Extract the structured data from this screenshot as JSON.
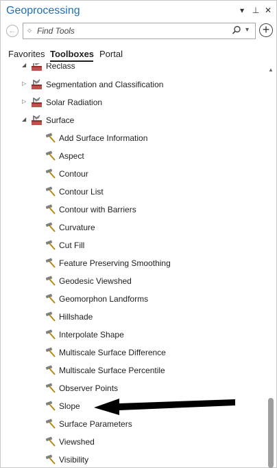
{
  "panel": {
    "title": "Geoprocessing"
  },
  "titlebar_buttons": [
    {
      "name": "options-menu-icon",
      "glyph": "▾"
    },
    {
      "name": "pin-icon",
      "glyph": "⊥"
    },
    {
      "name": "close-icon",
      "glyph": "✕"
    }
  ],
  "search": {
    "placeholder": "Find Tools",
    "value": ""
  },
  "tabs": [
    {
      "label": "Favorites",
      "active": false
    },
    {
      "label": "Toolboxes",
      "active": true
    },
    {
      "label": "Portal",
      "active": false
    }
  ],
  "tree": {
    "toolsets": [
      {
        "label": "Reclass",
        "expanded": true
      },
      {
        "label": "Segmentation and Classification",
        "expanded": false
      },
      {
        "label": "Solar Radiation",
        "expanded": false
      },
      {
        "label": "Surface",
        "expanded": true
      }
    ],
    "tools": [
      "Add Surface Information",
      "Aspect",
      "Contour",
      "Contour List",
      "Contour with Barriers",
      "Curvature",
      "Cut Fill",
      "Feature Preserving Smoothing",
      "Geodesic Viewshed",
      "Geomorphon Landforms",
      "Hillshade",
      "Interpolate Shape",
      "Multiscale Surface Difference",
      "Multiscale Surface Percentile",
      "Observer Points",
      "Slope",
      "Surface Parameters",
      "Viewshed",
      "Visibility"
    ]
  },
  "annotation": {
    "points_to": "Slope",
    "color": "#000000"
  },
  "colors": {
    "title": "#1d6fb8",
    "toolbox_icon": "#c0504d",
    "tool_head": "#7f7f7f",
    "tool_handle": "#b8860b"
  }
}
